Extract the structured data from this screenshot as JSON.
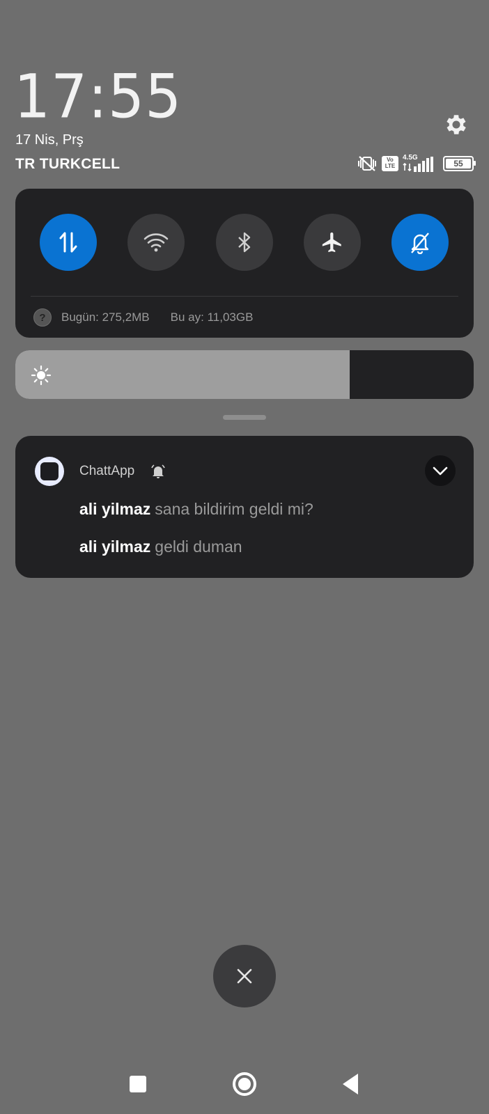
{
  "header": {
    "time": "17:55",
    "date": "17 Nis, Prş",
    "carrier": "TR TURKCELL",
    "network_type": "4.5G",
    "volte_label_top": "Vo",
    "volte_label_bottom": "LTE",
    "battery_level": "55"
  },
  "quick_settings": {
    "tiles": [
      {
        "name": "mobile-data",
        "icon": "arrows-updown-icon",
        "active": true
      },
      {
        "name": "wifi",
        "icon": "wifi-icon",
        "active": false
      },
      {
        "name": "bluetooth",
        "icon": "bluetooth-icon",
        "active": false
      },
      {
        "name": "airplane-mode",
        "icon": "airplane-icon",
        "active": false
      },
      {
        "name": "silent-mode",
        "icon": "bell-off-icon",
        "active": true
      }
    ],
    "usage_today": "Bugün: 275,2MB",
    "usage_month": "Bu ay: 11,03GB",
    "help_symbol": "?"
  },
  "brightness": {
    "level_fraction": 0.73
  },
  "notification": {
    "app_name": "ChattApp",
    "messages": [
      {
        "sender": "ali yilmaz",
        "text": "sana bildirim geldi mi?"
      },
      {
        "sender": "ali yilmaz",
        "text": "geldi duman"
      }
    ]
  },
  "colors": {
    "accent": "#0a73d2",
    "panel": "#212123",
    "background": "#6e6e6e"
  }
}
